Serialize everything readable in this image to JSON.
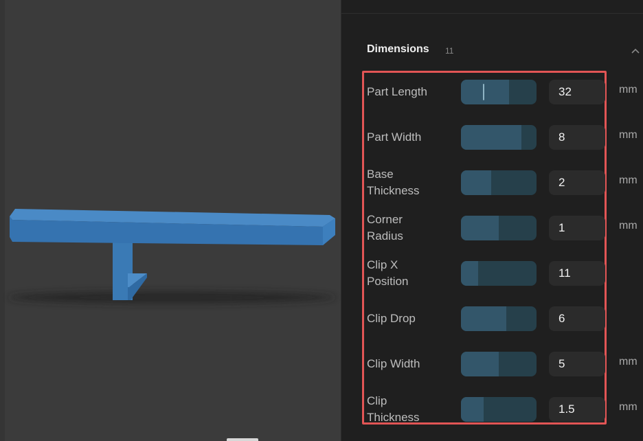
{
  "colors": {
    "viewport_bg": "#3b3b3b",
    "panel_bg": "#1f1f1f",
    "model_blue": "#3a7ab5",
    "slider_track": "#26404b",
    "slider_fill": "#33566a",
    "highlight_border": "#e25555"
  },
  "section": {
    "title": "Dimensions",
    "count": "11",
    "collapse_icon": "chevron-up-icon"
  },
  "params": [
    {
      "label": "Part Length",
      "value": "32",
      "unit": "mm",
      "fill": 0.64,
      "cursor": true
    },
    {
      "label": "Part Width",
      "value": "8",
      "unit": "mm",
      "fill": 0.8
    },
    {
      "label": "Base\nThickness",
      "value": "2",
      "unit": "mm",
      "fill": 0.4
    },
    {
      "label": "Corner\nRadius",
      "value": "1",
      "unit": "mm",
      "fill": 0.5
    },
    {
      "label": "Clip X\nPosition",
      "value": "11",
      "unit": "",
      "fill": 0.23
    },
    {
      "label": "Clip Drop",
      "value": "6",
      "unit": "",
      "fill": 0.6
    },
    {
      "label": "Clip Width",
      "value": "5",
      "unit": "mm",
      "fill": 0.5
    },
    {
      "label": "Clip\nThickness",
      "value": "1.5",
      "unit": "mm",
      "fill": 0.3
    }
  ]
}
